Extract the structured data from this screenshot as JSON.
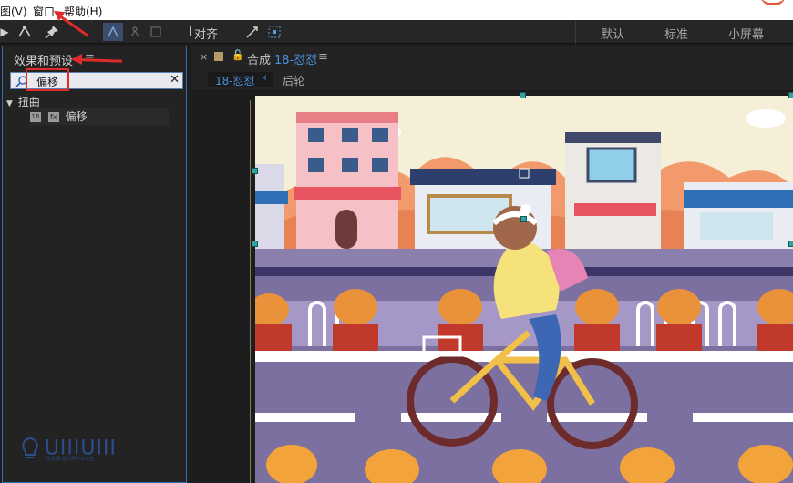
{
  "menu": {
    "view": "图(V)",
    "window": "窗口",
    "help": "帮助(H)"
  },
  "toolbar": {
    "align_label": "对齐"
  },
  "workspaces": {
    "default": "默认",
    "standard": "标准",
    "small_screen": "小屏幕"
  },
  "effects_panel": {
    "title": "效果和预设",
    "menu_glyph": "≡",
    "search_value": "偏移",
    "tree": {
      "category": "扭曲",
      "effect": "偏移"
    }
  },
  "comp_panel": {
    "close_glyph": "×",
    "comp_prefix": "合成",
    "comp_name": "18-怼怼",
    "menu_glyph": "≡",
    "crumb_active": "18-怼怼",
    "crumb_next": "后轮"
  },
  "watermark": {
    "text": "UIIIUIII",
    "sub": "优设网 设计师学习平台"
  },
  "colors": {
    "accent": "#2f6fb6",
    "comp_blue": "#4a90d9",
    "annotation_red": "#e02b2b"
  },
  "icons": {
    "search": "search-icon",
    "clear": "close-icon",
    "lock": "lock-icon",
    "comp": "composition-icon",
    "effect": "effect-icon",
    "pin": "pin-icon",
    "bezier": "bezier-pen-icon",
    "pointer": "pointer-icon"
  }
}
